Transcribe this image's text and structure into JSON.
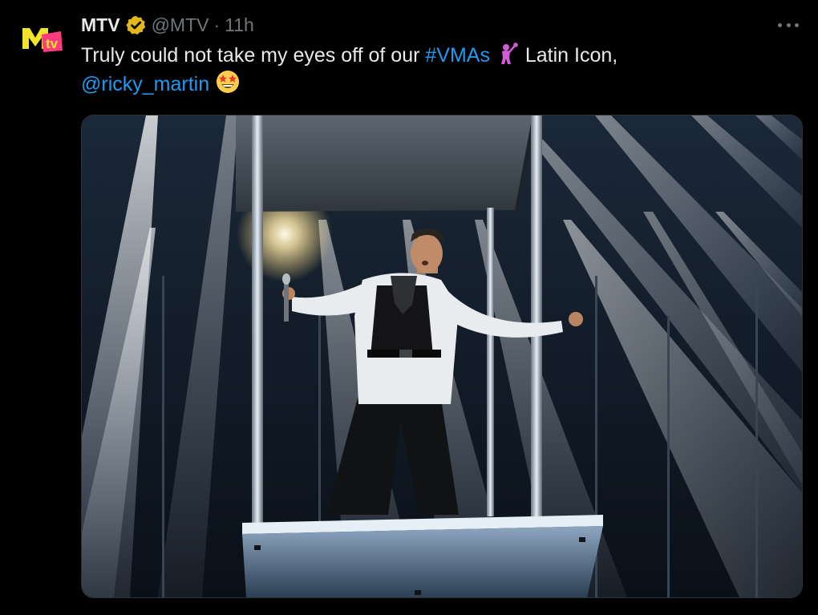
{
  "tweet": {
    "author_name": "MTV",
    "handle": "@MTV",
    "separator": "·",
    "time": "11h",
    "text_main": "Truly could not take my eyes off of our ",
    "hashtag": "#VMAs",
    "text_after": " Latin Icon,",
    "mention": "@ricky_martin"
  },
  "icons": {
    "avatar": "mtv-logo-icon",
    "verified": "verified-gold-badge-icon",
    "more": "more-options-icon",
    "emoji_singer": "singer-emoji-icon",
    "emoji_starstruck": "star-struck-emoji-icon"
  },
  "colors": {
    "background": "#000000",
    "text": "#e7e9ea",
    "muted": "#71767b",
    "link": "#1d9bf0",
    "verified_badge": "#e2b719"
  }
}
